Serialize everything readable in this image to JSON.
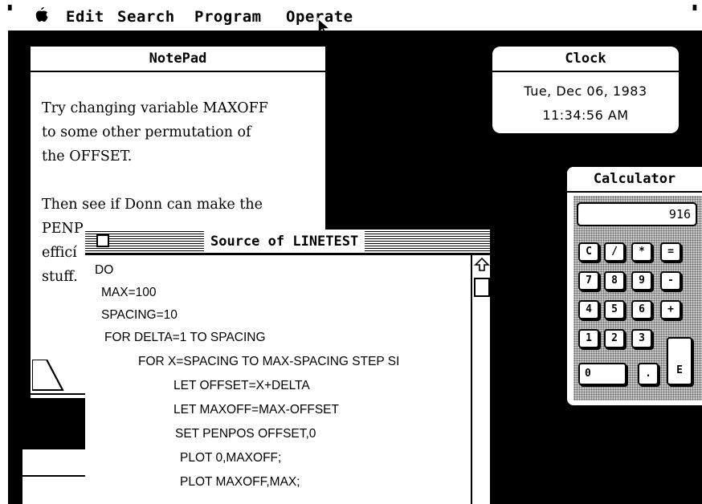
{
  "menubar": {
    "apple": "",
    "items": [
      "Edit",
      "Search",
      "Program",
      "Operate"
    ]
  },
  "notepad": {
    "title": "NotePad",
    "text": "Try changing variable MAXOFF\nto some other permutation of\nthe OFFSET.\n\nThen see if Donn can make the\nPENP\nefficí\nstuff."
  },
  "clock": {
    "title": "Clock",
    "date": "Tue, Dec 06, 1983",
    "time": "11:34:56 AM"
  },
  "calculator": {
    "title": "Calculator",
    "display": "916",
    "keys": [
      "C",
      "/",
      "*",
      "=",
      "7",
      "8",
      "9",
      "-",
      "4",
      "5",
      "6",
      "+",
      "1",
      "2",
      "3",
      "0",
      ".",
      "E"
    ]
  },
  "source_window": {
    "title": "Source of LINETEST",
    "lines": [
      "DO",
      "MAX=100",
      "SPACING=10",
      "FOR DELTA=1 TO SPACING",
      "FOR X=SPACING TO MAX-SPACING STEP SI",
      "LET OFFSET=X+DELTA",
      "LET MAXOFF=MAX-OFFSET",
      "SET PENPOS OFFSET,0",
      "PLOT 0,MAXOFF;",
      "PLOT MAXOFF,MAX;"
    ]
  }
}
